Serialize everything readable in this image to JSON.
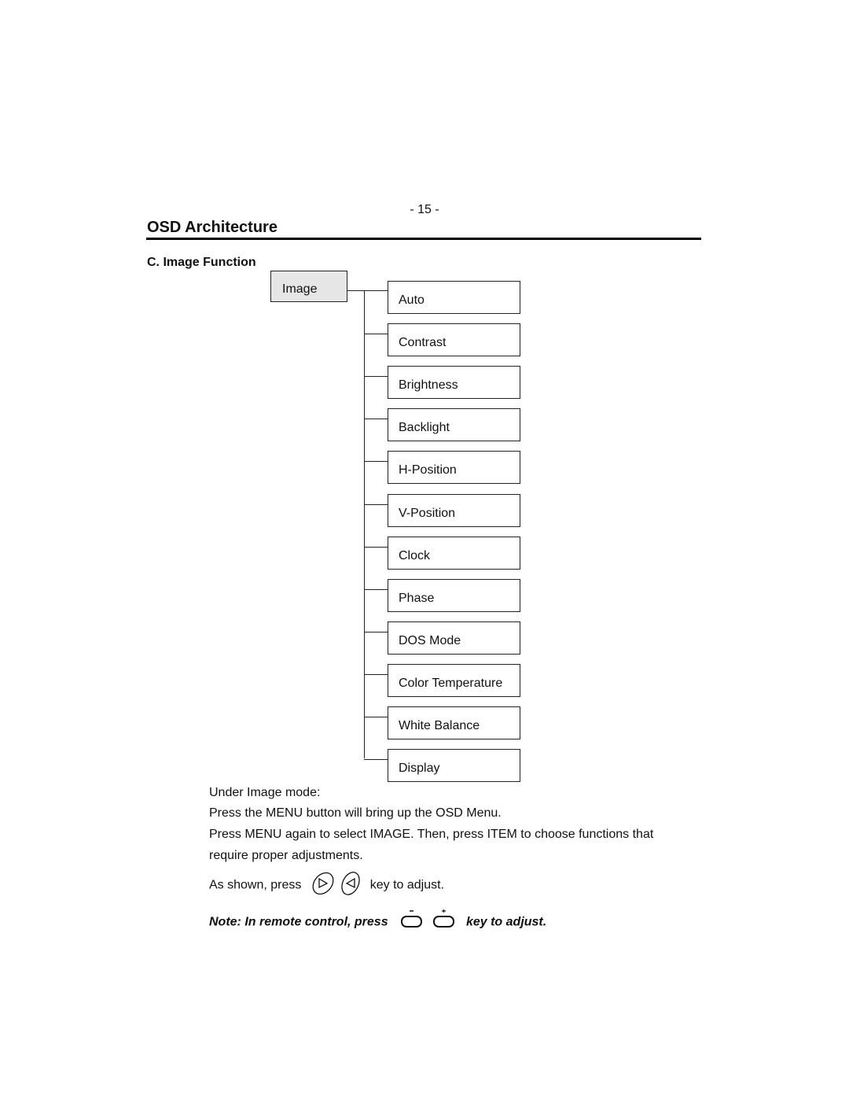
{
  "page": {
    "page_number": "- 15 -",
    "title": "OSD Architecture",
    "section": "C. Image Function"
  },
  "diagram": {
    "root": "Image",
    "items": [
      "Auto",
      "Contrast",
      "Brightness",
      "Backlight",
      "H-Position",
      "V-Position",
      "Clock",
      "Phase",
      "DOS Mode",
      "Color Temperature",
      "White Balance",
      "Display"
    ]
  },
  "instructions": {
    "line1": "Under Image mode:",
    "line2": "Press the MENU button will bring up the OSD Menu.",
    "line3": "Press MENU again to select IMAGE.  Then, press ITEM to choose functions that",
    "line4": "require proper adjustments.",
    "line5_prefix": "As shown, press",
    "line5_suffix": "key  to  adjust.",
    "keys": [
      "right-arrow-key-icon",
      "left-arrow-key-icon"
    ]
  },
  "note": {
    "prefix": "Note: In remote control, press",
    "suffix": "key to adjust.",
    "minus_label": "-",
    "plus_label": "+"
  }
}
